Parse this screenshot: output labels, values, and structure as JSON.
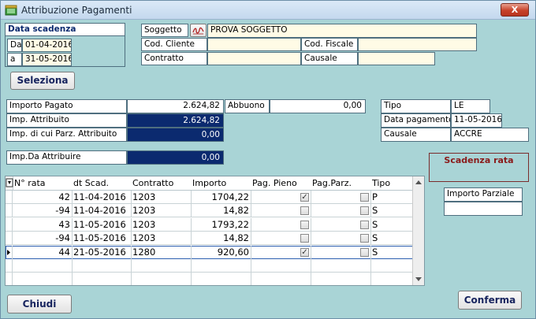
{
  "window": {
    "title": "Attribuzione Pagamenti",
    "close_label": "X"
  },
  "data_scadenza": {
    "title": "Data scadenza",
    "da_label": "Da",
    "da_value": "01-04-2016",
    "a_label": "a",
    "a_value": "31-05-2016"
  },
  "soggetto": {
    "label": "Soggetto",
    "value": "PROVA SOGGETTO",
    "cod_cliente_label": "Cod. Cliente",
    "cod_cliente_value": "",
    "cod_fiscale_label": "Cod. Fiscale",
    "cod_fiscale_value": "",
    "contratto_label": "Contratto",
    "contratto_value": "",
    "causale_label": "Causale",
    "causale_value": ""
  },
  "buttons": {
    "seleziona": "Seleziona",
    "chiudi": "Chiudi",
    "conferma": "Conferma"
  },
  "importi": {
    "importo_pagato_label": "Importo Pagato",
    "importo_pagato_value": "2.624,82",
    "abbuono_label": "Abbuono",
    "abbuono_value": "0,00",
    "imp_attribuito_label": "Imp. Attribuito",
    "imp_attribuito_value": "2.624,82",
    "imp_parz_label": "Imp. di cui Parz. Attribuito",
    "imp_parz_value": "0,00",
    "imp_da_attribuire_label": "Imp.Da Attribuire",
    "imp_da_attribuire_value": "0,00"
  },
  "pagamento": {
    "tipo_label": "Tipo",
    "tipo_value": "LE",
    "data_label": "Data pagamento",
    "data_value": "11-05-2016",
    "causale_label": "Causale",
    "causale_value": "ACCRE"
  },
  "scadenza_rata": {
    "title": "Scadenza rata"
  },
  "importo_parziale": {
    "label": "Importo Parziale",
    "value": ""
  },
  "grid": {
    "columns": [
      "N° rata",
      "dt Scad.",
      "Contratto",
      "Importo",
      "Pag. Pieno",
      "Pag.Parz.",
      "Tipo"
    ],
    "rows": [
      {
        "rata": "42",
        "dt": "11-04-2016",
        "contratto": "1203",
        "importo": "1704,22",
        "pieno": true,
        "parz": false,
        "tipo": "P"
      },
      {
        "rata": "-94",
        "dt": "11-04-2016",
        "contratto": "1203",
        "importo": "14,82",
        "pieno": false,
        "parz": false,
        "tipo": "S"
      },
      {
        "rata": "43",
        "dt": "11-05-2016",
        "contratto": "1203",
        "importo": "1793,22",
        "pieno": false,
        "parz": false,
        "tipo": "S"
      },
      {
        "rata": "-94",
        "dt": "11-05-2016",
        "contratto": "1203",
        "importo": "14,82",
        "pieno": false,
        "parz": false,
        "tipo": "S"
      },
      {
        "rata": "44",
        "dt": "21-05-2016",
        "contratto": "1280",
        "importo": "920,60",
        "pieno": true,
        "parz": false,
        "tipo": "S"
      }
    ]
  },
  "colors": {
    "background": "#a9d4d6",
    "field_yellow": "#fffbe6",
    "navy_field": "#0b2a6f",
    "button_text": "#17245e",
    "scadenza_border": "#7a2c2c"
  }
}
